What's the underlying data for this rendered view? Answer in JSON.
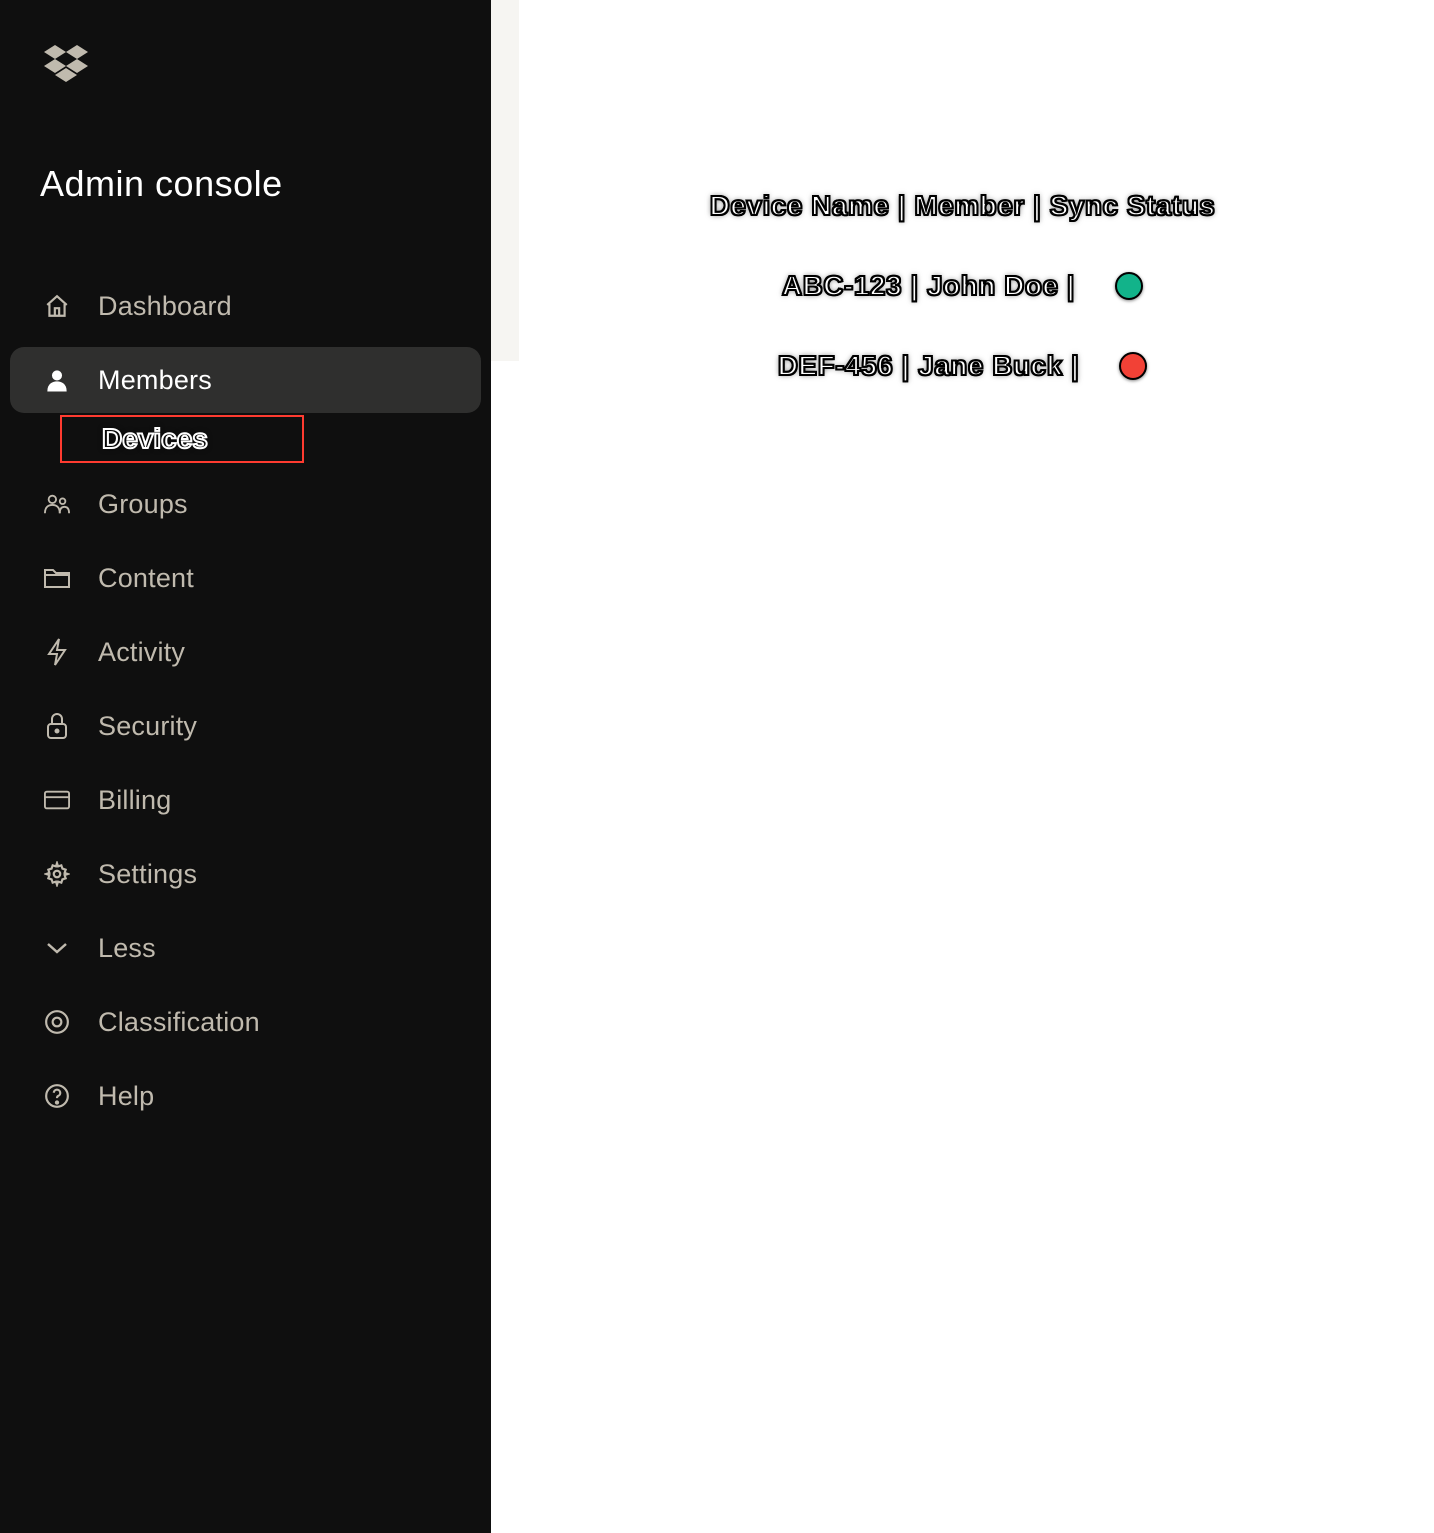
{
  "sidebar": {
    "title": "Admin console",
    "items": {
      "dashboard": "Dashboard",
      "members": "Members",
      "devices_sub": "Devices",
      "groups": "Groups",
      "content": "Content",
      "activity": "Activity",
      "security": "Security",
      "billing": "Billing",
      "settings": "Settings",
      "less": "Less",
      "classification": "Classification",
      "help": "Help"
    }
  },
  "main": {
    "header": "Device Name | Member | Sync Status",
    "rows": {
      "r0": "ABC-123 | John Doe |",
      "r1": "DEF-456 | Jane Buck |"
    },
    "status_colors": {
      "ok": "#12b38a",
      "err": "#f24136"
    }
  }
}
